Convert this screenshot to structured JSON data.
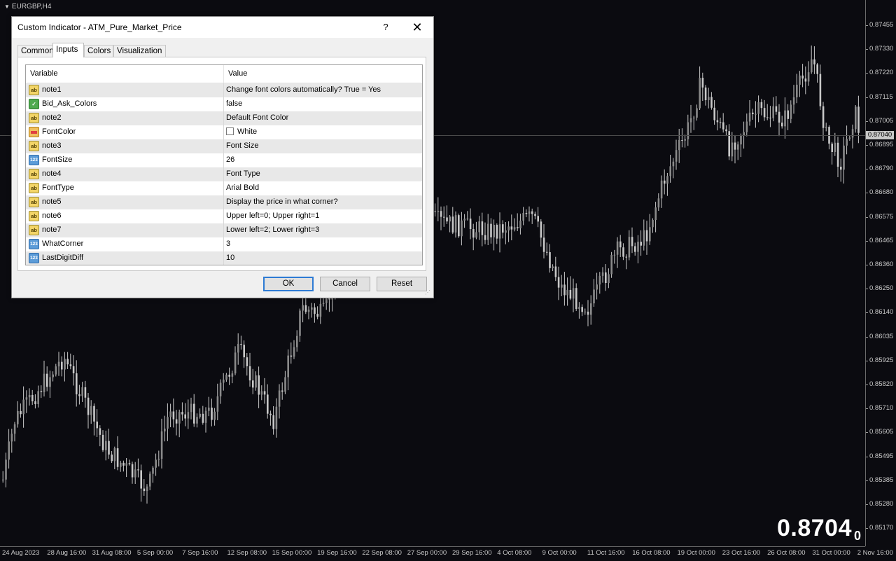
{
  "chart": {
    "symbol": "EURGBP,H4",
    "current_price_label": "0.87040",
    "price_ticks": [
      "0.87455",
      "0.87330",
      "0.87220",
      "0.87115",
      "0.87005",
      "0.86895",
      "0.86790",
      "0.86680",
      "0.86575",
      "0.86465",
      "0.86360",
      "0.86250",
      "0.86140",
      "0.86035",
      "0.85925",
      "0.85820",
      "0.85710",
      "0.85605",
      "0.85495",
      "0.85385",
      "0.85280",
      "0.85170"
    ],
    "time_ticks": [
      "24 Aug 2023",
      "28 Aug 16:00",
      "31 Aug 08:00",
      "5 Sep 00:00",
      "7 Sep 16:00",
      "12 Sep 08:00",
      "15 Sep 00:00",
      "19 Sep 16:00",
      "22 Sep 08:00",
      "27 Sep 00:00",
      "29 Sep 16:00",
      "4 Oct 08:00",
      "9 Oct 00:00",
      "11 Oct 16:00",
      "16 Oct 08:00",
      "19 Oct 00:00",
      "23 Oct 16:00",
      "26 Oct 08:00",
      "31 Oct 00:00",
      "2 Nov 16:00"
    ],
    "big_price": "0.8704",
    "big_digit": "0",
    "colors": {
      "background": "#0b0b10",
      "candles": "#c8c8c8"
    }
  },
  "dialog": {
    "title": "Custom Indicator - ATM_Pure_Market_Price",
    "help_label": "?",
    "close_label": "✕",
    "tabs": [
      {
        "label": "Common"
      },
      {
        "label": "Inputs"
      },
      {
        "label": "Colors"
      },
      {
        "label": "Visualization"
      }
    ],
    "active_tab": "Inputs",
    "columns": {
      "variable": "Variable",
      "value": "Value"
    },
    "rows": [
      {
        "type": "string-icon",
        "name": "note1",
        "value": "Change font colors automatically? True = Yes"
      },
      {
        "type": "bool-icon",
        "name": "Bid_Ask_Colors",
        "value": "false"
      },
      {
        "type": "string-icon",
        "name": "note2",
        "value": "Default Font Color"
      },
      {
        "type": "color-icon",
        "name": "FontColor",
        "value": "White"
      },
      {
        "type": "string-icon",
        "name": "note3",
        "value": "Font Size"
      },
      {
        "type": "int-icon",
        "name": "FontSize",
        "value": "26"
      },
      {
        "type": "string-icon",
        "name": "note4",
        "value": "Font Type"
      },
      {
        "type": "string-icon",
        "name": "FontType",
        "value": "Arial Bold"
      },
      {
        "type": "string-icon",
        "name": "note5",
        "value": "Display the price in what corner?"
      },
      {
        "type": "string-icon",
        "name": "note6",
        "value": "Upper left=0; Upper right=1"
      },
      {
        "type": "string-icon",
        "name": "note7",
        "value": "Lower left=2; Lower right=3"
      },
      {
        "type": "int-icon",
        "name": "WhatCorner",
        "value": "3"
      },
      {
        "type": "int-icon",
        "name": "LastDigitDiff",
        "value": "10"
      }
    ],
    "icon_glyphs": {
      "string": "ab",
      "bool": "✓",
      "int": "123"
    },
    "buttons": {
      "ok": "OK",
      "cancel": "Cancel",
      "reset": "Reset"
    }
  }
}
